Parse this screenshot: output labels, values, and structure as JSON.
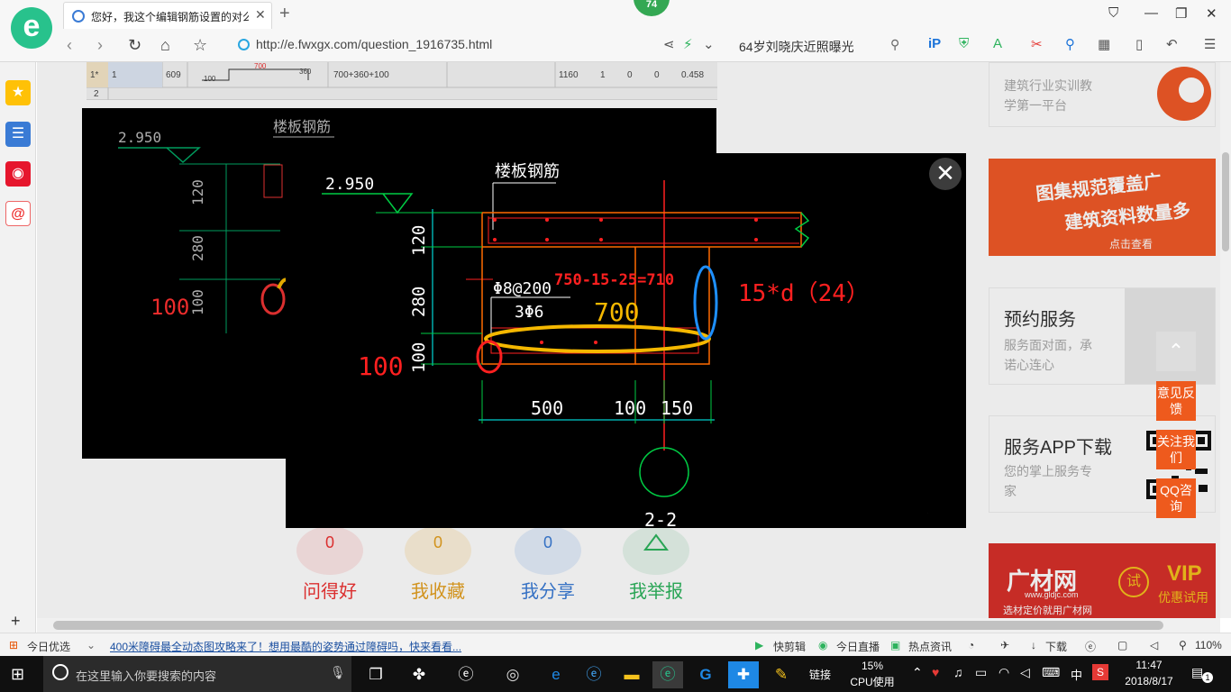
{
  "browser": {
    "tab_title": "您好，我这个编辑钢筋设置的对么",
    "badge": "74",
    "url": "http://e.fwxgx.com/question_1916735.html",
    "search_text": "64岁刘晓庆近照曝光"
  },
  "sheet_row": {
    "row1": [
      "1*",
      "1",
      "609",
      "700",
      "360",
      "700+360+100",
      "1160",
      "1",
      "0",
      "0",
      "0.458"
    ],
    "row2": "2",
    "sub_label": "100"
  },
  "drawing": {
    "title": "楼板钢筋",
    "elevation": "2.950",
    "dim_120": "120",
    "dim_280": "280",
    "dim_100": "100",
    "stirrup": "Φ8@200",
    "bars": "3Φ6",
    "dim_500": "500",
    "dim_100b": "100",
    "dim_150": "150",
    "section": "2-2",
    "annotation_calc": "750-15-25=710",
    "annotation_700": "700",
    "annotation_15d": "15*d（24）",
    "annotation_100": "100",
    "bg_annotation_100": "100",
    "colors": {
      "red": "#ff2020",
      "yellow": "#f5b800",
      "blue": "#1e90ff",
      "green": "#00cc44",
      "cyan": "#00ffff",
      "orange": "#ff6a00",
      "white": "#ffffff"
    }
  },
  "stats": [
    {
      "count": "0",
      "label": "问得好"
    },
    {
      "count": "0",
      "label": "我收藏"
    },
    {
      "count": "0",
      "label": "我分享"
    },
    {
      "count": "",
      "label": "我举报"
    }
  ],
  "right": {
    "card0_text1": "建筑行业实训教",
    "card0_text2": "学第一平台",
    "ad1_title": "图集规范覆盖广",
    "ad1_sub": "建筑资料数量多",
    "ad1_link": "点击查看",
    "service_title": "预约服务",
    "service_text1": "服务面对面，承",
    "service_text2": "诺心连心",
    "app_title": "服务APP下载",
    "app_text1": "您的掌上服务专",
    "app_text2": "家",
    "ad2_brand": "广材网",
    "ad2_url": "www.gldjc.com",
    "ad2_slogan": "选材定价就用广材网",
    "ad2_vip": "VIP",
    "ad2_vip_sub": "优惠试用",
    "ad2_try": "试"
  },
  "float": {
    "feedback": "意见反馈",
    "follow": "关注我们",
    "qq": "QQ咨询"
  },
  "statusbar": {
    "left_label": "今日优选",
    "news": "400米障碍最全动态图攻略来了！想用最酷的姿势通过障碍吗，快来看看...",
    "kuaijianji": "快剪辑",
    "live": "今日直播",
    "hot": "热点资讯",
    "download": "下载",
    "zoom": "110%"
  },
  "taskbar": {
    "search_placeholder": "在这里输入你要搜索的内容",
    "link_label": "链接",
    "cpu_percent": "15%",
    "cpu_label": "CPU使用",
    "ime": "中",
    "time": "11:47",
    "date": "2018/8/17",
    "notif": "1"
  }
}
